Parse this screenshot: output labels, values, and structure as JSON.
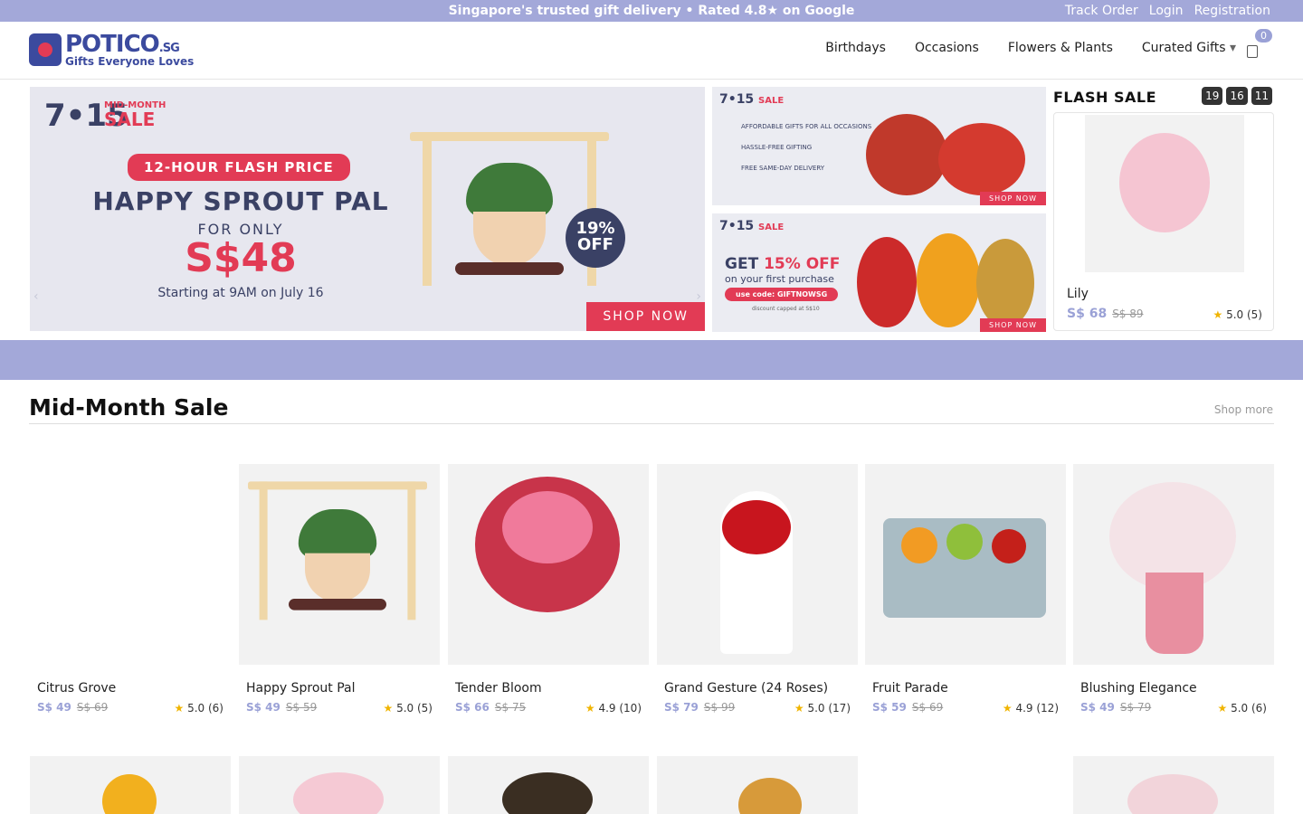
{
  "topbar": {
    "promo": "Singapore's trusted gift delivery • Rated 4.8★ on Google",
    "links": [
      "Track Order",
      "Login",
      "Registration"
    ]
  },
  "header": {
    "logo_name": "POTICO",
    "logo_suffix": ".SG",
    "logo_tag": "Gifts Everyone Loves",
    "nav": [
      "Birthdays",
      "Occasions",
      "Flowers & Plants",
      "Curated Gifts"
    ],
    "cart_count": "0"
  },
  "hero": {
    "sale_logo": "7•15",
    "sale_sub_top": "MID-MONTH",
    "sale_sub_main": "SALE",
    "pill": "12-HOUR FLASH PRICE",
    "title": "HAPPY SPROUT PAL",
    "for_only": "FOR ONLY",
    "price": "S$48",
    "start": "Starting at 9AM on July 16",
    "off_pct": "19%",
    "off_word": "OFF",
    "cta": "SHOP NOW"
  },
  "side_banners": {
    "b1": {
      "logo": "7•15",
      "logo_sale": "SALE",
      "items": [
        "AFFORDABLE GIFTS FOR ALL OCCASIONS",
        "HASSLE-FREE GIFTING",
        "FREE SAME-DAY DELIVERY"
      ],
      "cta": "SHOP NOW"
    },
    "b2": {
      "logo": "7•15",
      "logo_sale": "SALE",
      "head_pre": "GET ",
      "head_em": "15% OFF",
      "sub": "on your first purchase",
      "code": "use code: GIFTNOWSG",
      "cap": "discount capped at S$10",
      "cta": "SHOP NOW"
    }
  },
  "flash_sale": {
    "title": "FLASH SALE",
    "timer": [
      "19",
      "16",
      "11"
    ],
    "product": {
      "name": "Lily",
      "price": "S$ 68",
      "was": "S$ 89",
      "rating": "5.0 (5)"
    }
  },
  "section": {
    "title": "Mid-Month Sale",
    "shop_more": "Shop more"
  },
  "products": [
    {
      "name": "Citrus Grove",
      "price": "S$ 49",
      "was": "S$ 69",
      "rating": "5.0 (6)"
    },
    {
      "name": "Happy Sprout Pal",
      "price": "S$ 49",
      "was": "S$ 59",
      "rating": "5.0 (5)"
    },
    {
      "name": "Tender Bloom",
      "price": "S$ 66",
      "was": "S$ 75",
      "rating": "4.9 (10)"
    },
    {
      "name": "Grand Gesture (24 Roses)",
      "price": "S$ 79",
      "was": "S$ 99",
      "rating": "5.0 (17)"
    },
    {
      "name": "Fruit Parade",
      "price": "S$ 59",
      "was": "S$ 69",
      "rating": "4.9 (12)"
    },
    {
      "name": "Blushing Elegance",
      "price": "S$ 49",
      "was": "S$ 79",
      "rating": "5.0 (6)"
    }
  ],
  "icons": {
    "star": "star-icon",
    "cart": "cart-icon",
    "chevron": "chevron-down-icon"
  },
  "colors": {
    "accent": "#a3a8d9",
    "brand": "#3b4a9e",
    "sale_red": "#e23b55",
    "price": "#9aa1d6"
  }
}
